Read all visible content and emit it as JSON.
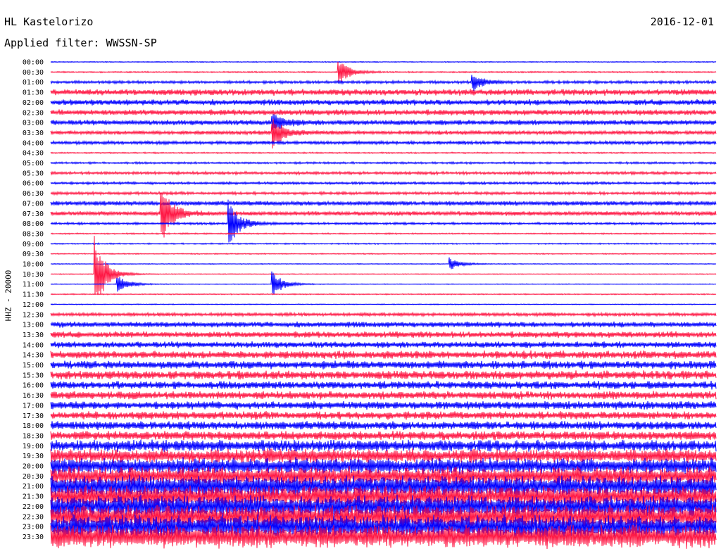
{
  "header": {
    "station": "HL Kastelorizo",
    "date": "2016-12-01",
    "filter": "Applied filter: WWSSN-SP",
    "channel": "HHZ - 20000"
  },
  "chart_data": {
    "type": "line",
    "title": "HL Kastelorizo",
    "subtitle": "Applied filter: WWSSN-SP",
    "ylabel": "HHZ - 20000",
    "xlabel": "",
    "row_labels": [
      "00:00",
      "00:30",
      "01:00",
      "01:30",
      "02:00",
      "02:30",
      "03:00",
      "03:30",
      "04:00",
      "04:30",
      "05:00",
      "05:30",
      "06:00",
      "06:30",
      "07:00",
      "07:30",
      "08:00",
      "08:30",
      "09:00",
      "09:30",
      "10:00",
      "10:30",
      "11:00",
      "11:30",
      "12:00",
      "12:30",
      "13:00",
      "13:30",
      "14:00",
      "14:30",
      "15:00",
      "15:30",
      "16:00",
      "16:30",
      "17:00",
      "17:30",
      "18:00",
      "18:30",
      "19:00",
      "19:30",
      "20:00",
      "20:30",
      "21:00",
      "21:30",
      "22:00",
      "22:30",
      "23:00",
      "23:30"
    ],
    "row_minutes": 30,
    "colors": [
      "#0000ff",
      "#ff1744"
    ],
    "noise_level": [
      0.08,
      0.12,
      0.25,
      0.55,
      0.5,
      0.5,
      0.45,
      0.35,
      0.3,
      0.12,
      0.18,
      0.25,
      0.22,
      0.25,
      0.4,
      0.38,
      0.2,
      0.12,
      0.12,
      0.1,
      0.07,
      0.07,
      0.07,
      0.1,
      0.08,
      0.3,
      0.5,
      0.55,
      0.55,
      0.7,
      0.7,
      0.75,
      0.7,
      0.7,
      0.7,
      0.7,
      0.75,
      0.8,
      1.0,
      1.2,
      1.4,
      1.6,
      1.8,
      1.8,
      1.9,
      2.0,
      2.0,
      2.0
    ],
    "events": [
      {
        "row": 1,
        "minute": 13,
        "amp": 2.0
      },
      {
        "row": 2,
        "minute": 19,
        "amp": 1.5
      },
      {
        "row": 6,
        "minute": 10,
        "amp": 1.5
      },
      {
        "row": 7,
        "minute": 10,
        "amp": 2.5
      },
      {
        "row": 15,
        "minute": 5,
        "amp": 4.5
      },
      {
        "row": 16,
        "minute": 8,
        "amp": 4.0
      },
      {
        "row": 20,
        "minute": 18,
        "amp": 1.0
      },
      {
        "row": 21,
        "minute": 2,
        "amp": 6.0
      },
      {
        "row": 22,
        "minute": 3,
        "amp": 1.5
      },
      {
        "row": 22,
        "minute": 10,
        "amp": 2.0
      }
    ]
  }
}
